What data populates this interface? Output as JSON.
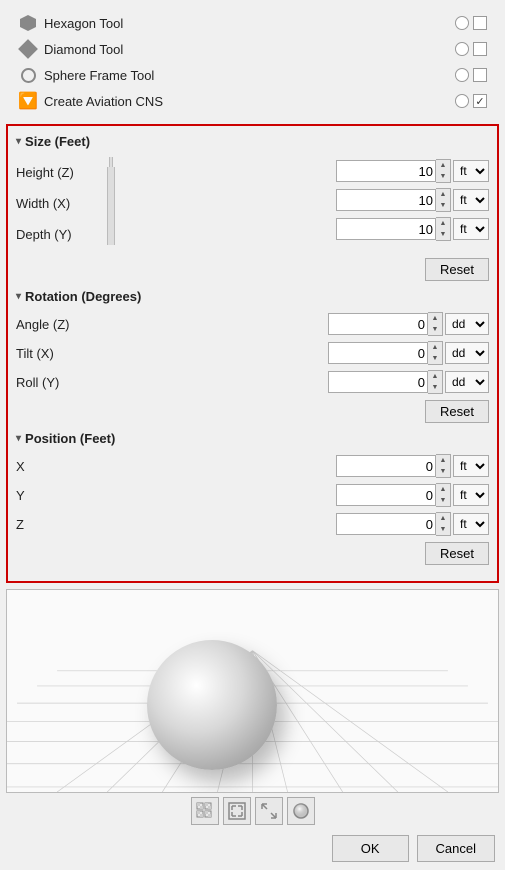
{
  "tools": [
    {
      "id": "hexagon",
      "name": "Hexagon Tool",
      "icon": "hexagon",
      "radio": true,
      "checked": false
    },
    {
      "id": "diamond",
      "name": "Diamond Tool",
      "icon": "diamond",
      "radio": true,
      "checked": false
    },
    {
      "id": "sphere-frame",
      "name": "Sphere Frame Tool",
      "icon": "sphere-frame",
      "radio": true,
      "checked": false
    },
    {
      "id": "aviation-cns",
      "name": "Create Aviation CNS",
      "icon": "funnel",
      "radio": true,
      "checked": true
    }
  ],
  "size_section": {
    "title": "Size (Feet)",
    "fields": [
      {
        "label": "Height (Z)",
        "value": "10",
        "unit": "ft"
      },
      {
        "label": "Width (X)",
        "value": "10",
        "unit": "ft"
      },
      {
        "label": "Depth (Y)",
        "value": "10",
        "unit": "ft"
      }
    ],
    "reset_label": "Reset"
  },
  "rotation_section": {
    "title": "Rotation (Degrees)",
    "fields": [
      {
        "label": "Angle (Z)",
        "value": "0",
        "unit": "dd"
      },
      {
        "label": "Tilt (X)",
        "value": "0",
        "unit": "dd"
      },
      {
        "label": "Roll (Y)",
        "value": "0",
        "unit": "dd"
      }
    ],
    "reset_label": "Reset"
  },
  "position_section": {
    "title": "Position (Feet)",
    "fields": [
      {
        "label": "X",
        "value": "0",
        "unit": "ft"
      },
      {
        "label": "Y",
        "value": "0",
        "unit": "ft"
      },
      {
        "label": "Z",
        "value": "0",
        "unit": "ft"
      }
    ],
    "reset_label": "Reset"
  },
  "preview_toolbar": [
    {
      "id": "grid-toggle",
      "symbol": "⊞"
    },
    {
      "id": "fit-view",
      "symbol": "⛶"
    },
    {
      "id": "expand-view",
      "symbol": "⤢"
    },
    {
      "id": "sphere-view",
      "symbol": "◎"
    }
  ],
  "footer": {
    "ok_label": "OK",
    "cancel_label": "Cancel"
  }
}
